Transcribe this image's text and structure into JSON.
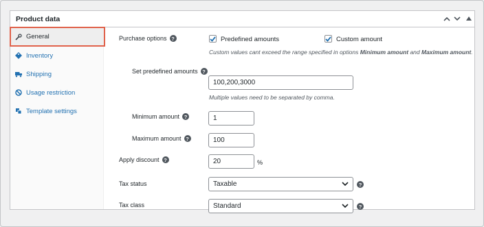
{
  "panel": {
    "title": "Product data"
  },
  "tabs": [
    {
      "label": "General",
      "icon": "wrench-icon",
      "active": true
    },
    {
      "label": "Inventory",
      "icon": "tag-icon",
      "active": false
    },
    {
      "label": "Shipping",
      "icon": "truck-icon",
      "active": false
    },
    {
      "label": "Usage restriction",
      "icon": "block-icon",
      "active": false
    },
    {
      "label": "Template settings",
      "icon": "template-icon",
      "active": false
    }
  ],
  "fields": {
    "purchase_options_label": "Purchase options",
    "predefined_label": "Predefined amounts",
    "predefined_checked": true,
    "custom_label": "Custom amount",
    "custom_checked": true,
    "custom_desc_pre": "Custom values cant exceed the range specified in options ",
    "custom_desc_min": "Minimum amount",
    "custom_desc_and": " and ",
    "custom_desc_max": "Maximum amount",
    "custom_desc_end": ".",
    "set_predefined_label": "Set predefined amounts",
    "set_predefined_value": "100,200,3000",
    "set_predefined_desc": "Multiple values need to be separated by comma.",
    "min_label": "Minimum amount",
    "min_value": "1",
    "max_label": "Maximum amount",
    "max_value": "100",
    "discount_label": "Apply discount",
    "discount_value": "20",
    "discount_unit": "%",
    "tax_status_label": "Tax status",
    "tax_status_value": "Taxable",
    "tax_class_label": "Tax class",
    "tax_class_value": "Standard"
  },
  "colors": {
    "accent": "#2271b1",
    "highlight": "#e0614a"
  }
}
